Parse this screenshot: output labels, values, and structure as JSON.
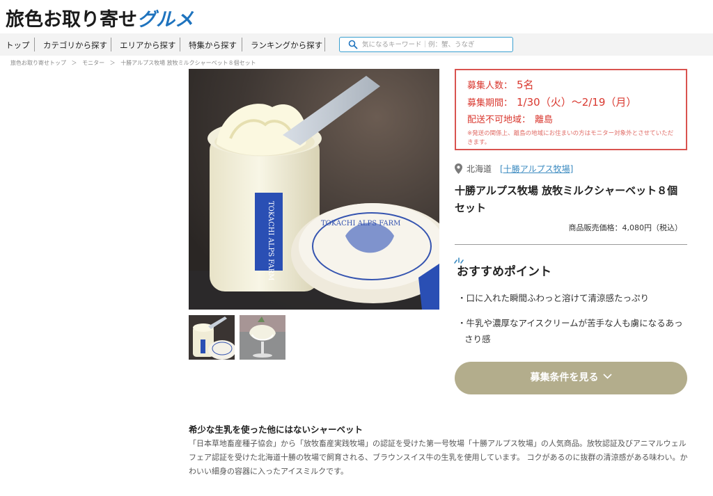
{
  "header": {
    "logo_main": "旅色お取り寄せ",
    "logo_accent": "グルメ"
  },
  "nav": {
    "items": [
      {
        "label": "トップ"
      },
      {
        "label": "カテゴリから探す"
      },
      {
        "label": "エリアから探す"
      },
      {
        "label": "特集から探す"
      },
      {
        "label": "ランキングから探す"
      }
    ],
    "search_placeholder": "気になるキーワード｜例：蟹、うなぎ"
  },
  "breadcrumb": {
    "items": [
      "旅色お取り寄せトップ",
      "＞",
      "モニター",
      "＞",
      "十勝アルプス牧場 放牧ミルクシャーベット８個セット"
    ]
  },
  "recruitment": {
    "count_label": "募集人数：",
    "count_value": "5名",
    "period_label": "募集期間：",
    "period_value": "1/30（火）～2/19（月）",
    "excluded_label": "配送不可地域：",
    "excluded_value": "離島",
    "note": "※発送の関係上、離島の地域にお住まいの方はモニター対象外とさせていただきます。"
  },
  "product": {
    "region": "北海道",
    "farm": "[十勝アルプス牧場]",
    "title": "十勝アルプス牧場 放牧ミルクシャーベット８個セット",
    "price": "商品販売価格：4,080円（税込）"
  },
  "recommend": {
    "heading": "おすすめポイント",
    "points": [
      "・口に入れた瞬間ふわっと溶けて清涼感たっぷり",
      "・牛乳や濃厚なアイスクリームが苦手な人も虜になるあっさり感"
    ]
  },
  "cta": {
    "label": "募集条件を見る"
  },
  "description": {
    "title": "希少な生乳を使った他にはないシャーベット",
    "body": "「日本草地畜産種子協会」から「放牧畜産実践牧場」の認証を受けた第一号牧場「十勝アルプス牧場」の人気商品。放牧認証及びアニマルウェルフェア認証を受けた北海道十勝の牧場で飼育される、ブラウンスイス牛の生乳を使用しています。 コクがあるのに抜群の清涼感がある味わい。かわいい細身の容器に入ったアイスミルクです。"
  },
  "images": {
    "cup_label": "TOKACHI ALPS FARM",
    "lid_label": "TOKACHI ALPS FARM"
  },
  "colors": {
    "accent_red": "#d9382f",
    "button": "#b3ad8c",
    "link": "#3a8ac0",
    "logo_accent": "#1e73be"
  }
}
